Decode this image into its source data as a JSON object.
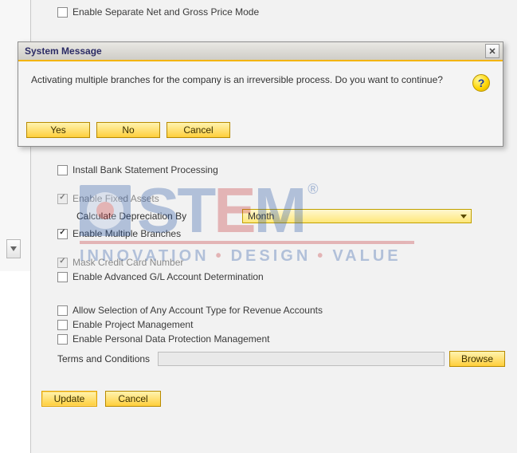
{
  "settings": {
    "net_gross": {
      "label": "Enable Separate Net and Gross Price Mode",
      "checked": false,
      "disabled": false
    },
    "bank_stmt": {
      "label": "Install Bank Statement Processing",
      "checked": false,
      "disabled": false
    },
    "fixed_assets": {
      "label": "Enable Fixed Assets",
      "checked": true,
      "disabled": true
    },
    "depreciation": {
      "label": "Calculate Depreciation By",
      "value": "Month"
    },
    "multi_branches": {
      "label": "Enable Multiple Branches",
      "checked": true,
      "disabled": false
    },
    "mask_cc": {
      "label": "Mask Credit Card Number",
      "checked": true,
      "disabled": true
    },
    "adv_gl": {
      "label": "Enable Advanced G/L Account Determination",
      "checked": false,
      "disabled": false
    },
    "acct_type": {
      "label": "Allow Selection of Any Account Type for Revenue Accounts",
      "checked": false,
      "disabled": false
    },
    "proj_mgmt": {
      "label": "Enable Project Management",
      "checked": false,
      "disabled": false
    },
    "pdpm": {
      "label": "Enable Personal Data Protection Management",
      "checked": false,
      "disabled": false
    },
    "terms_label": "Terms and Conditions",
    "browse": "Browse"
  },
  "footer": {
    "update": "Update",
    "cancel": "Cancel"
  },
  "dialog": {
    "title": "System Message",
    "message": "Activating multiple branches for the company is an irreversible process. Do you want to continue?",
    "yes": "Yes",
    "no": "No",
    "cancel": "Cancel",
    "icon_glyph": "?"
  },
  "watermark": {
    "brand_s": "S",
    "brand_t": "T",
    "brand_e": "E",
    "brand_m": "M",
    "reg": "®",
    "tag1": "INNOVATION",
    "tag2": "DESIGN",
    "tag3": "VALUE",
    "dot": "•"
  }
}
